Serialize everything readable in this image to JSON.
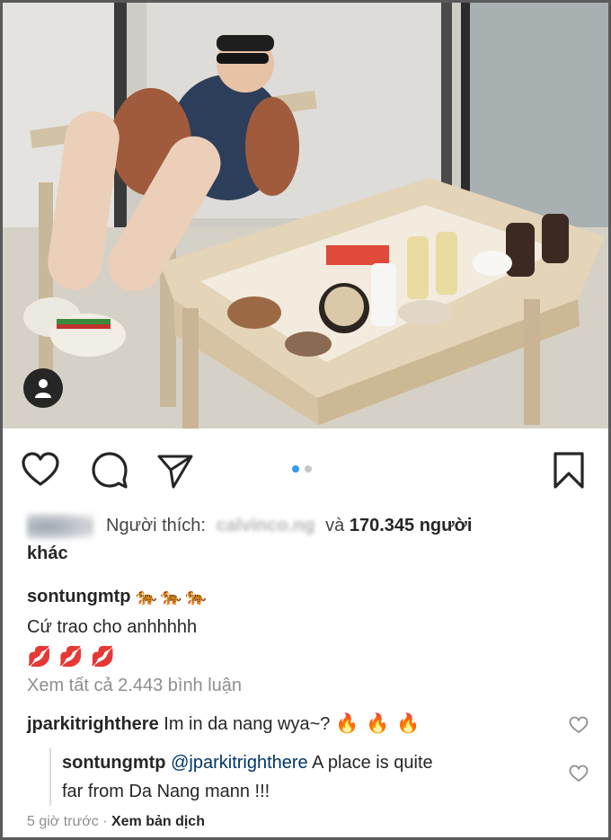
{
  "post": {
    "photo_description": "photo",
    "carousel": {
      "count": 2,
      "active_index": 0
    }
  },
  "likes": {
    "prefix": "Người thích:",
    "blurred_name": "calvinco.ng",
    "conjunction": "và",
    "count_text": "170.345 người",
    "suffix": "khác"
  },
  "caption": {
    "username": "sontungmtp",
    "emoji_tigers": "🐅🐅🐅",
    "text": "Cứ trao cho anhhhhh",
    "emoji_kisses": "💋💋💋"
  },
  "view_all_comments": "Xem tất cả 2.443 bình luận",
  "comments": [
    {
      "username": "jparkitrighthere",
      "text": "Im in da nang wya~?",
      "emoji": "🔥🔥🔥"
    }
  ],
  "reply": {
    "username": "sontungmtp",
    "mention": "@jparkitrighthere",
    "text_line1": "A place is quite",
    "text_line2": "far from Da Nang mann !!!"
  },
  "meta": {
    "time": "5 giờ trước",
    "separator": "·",
    "translate_label": "Xem bản dịch"
  },
  "colors": {
    "text": "#262626",
    "muted": "#8e8e8e",
    "carousel_active": "#3897f0",
    "mention": "#003569"
  }
}
